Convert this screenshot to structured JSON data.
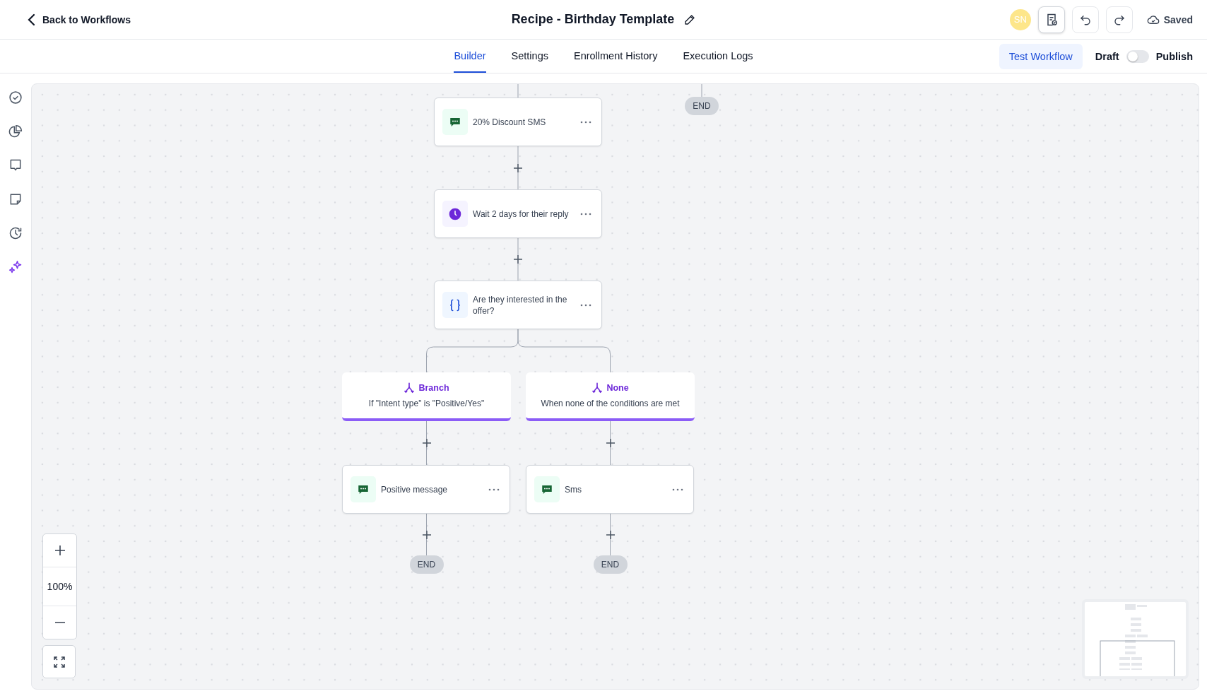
{
  "header": {
    "back_label": "Back to Workflows",
    "title": "Recipe - Birthday Template",
    "avatar_initials": "SN",
    "save_status": "Saved"
  },
  "tabs": [
    {
      "label": "Builder",
      "selected": true
    },
    {
      "label": "Settings",
      "selected": false
    },
    {
      "label": "Enrollment History",
      "selected": false
    },
    {
      "label": "Execution Logs",
      "selected": false
    }
  ],
  "test_button": "Test Workflow",
  "publish_toggle": {
    "off_label": "Draft",
    "on_label": "Publish",
    "on": false
  },
  "canvas": {
    "side_end": "END",
    "steps": [
      {
        "kind": "sms",
        "label": "20% Discount SMS"
      },
      {
        "kind": "wait",
        "label": "Wait 2 days for their reply"
      },
      {
        "kind": "condition",
        "label": "Are they interested in the offer?"
      }
    ],
    "branches": [
      {
        "title": "Branch",
        "condition": "If \"Intent type\" is \"Positive/Yes\"",
        "action": {
          "kind": "sms",
          "label": "Positive message"
        },
        "end": "END"
      },
      {
        "title": "None",
        "condition": "When none of the conditions are met",
        "action": {
          "kind": "sms",
          "label": "Sms"
        },
        "end": "END"
      }
    ],
    "zoom_level": "100%"
  }
}
